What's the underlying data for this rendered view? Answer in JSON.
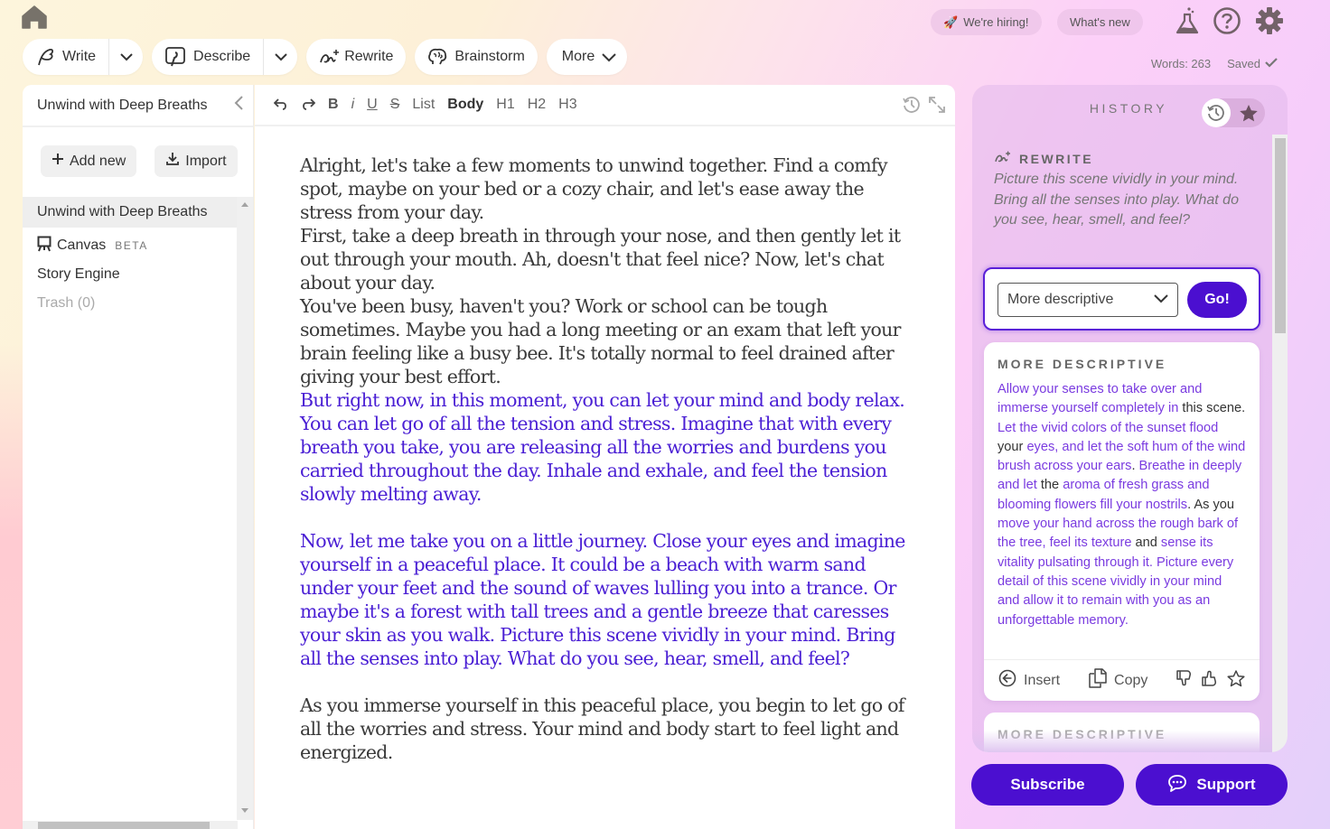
{
  "top": {
    "buttons": [
      {
        "label": "Write",
        "icon": "quill-icon",
        "has_dropdown": true
      },
      {
        "label": "Describe",
        "icon": "describe-icon",
        "has_dropdown": true
      },
      {
        "label": "Rewrite",
        "icon": "rewrite-icon",
        "has_dropdown": false
      },
      {
        "label": "Brainstorm",
        "icon": "brain-icon",
        "has_dropdown": false
      },
      {
        "label": "More",
        "icon": "chevron-down-icon",
        "has_dropdown": true
      }
    ],
    "hiring_label": "We're hiring!",
    "whats_new_label": "What's new",
    "words": "Words: 263",
    "saved": "Saved"
  },
  "sidebar": {
    "doc_title": "Unwind with Deep Breaths",
    "add_new": "Add new",
    "import": "Import",
    "items": [
      {
        "label": "Unwind with Deep Breaths",
        "active": true
      },
      {
        "label": "Canvas",
        "badge": "BETA"
      },
      {
        "label": "Story Engine"
      },
      {
        "label": "Trash (0)"
      }
    ]
  },
  "editor": {
    "toolbar": [
      "List",
      "Body",
      "H1",
      "H2",
      "H3"
    ],
    "format_buttons": {
      "bold": "B",
      "italic": "i",
      "underline": "U",
      "strike": "S"
    },
    "paragraphs": [
      {
        "text": "Alright, let's take a few moments to unwind together. Find a comfy spot, maybe on your bed or a cozy chair, and let's ease away the stress from your day.",
        "generated": false
      },
      {
        "text": "First, take a deep breath in through your nose, and then gently let it out through your mouth. Ah, doesn't that feel nice? Now, let's chat about your day.",
        "generated": false
      },
      {
        "text": "You've been busy, haven't you? Work or school can be tough sometimes. Maybe you had a long meeting or an exam that left your brain feeling like a busy bee. It's totally normal to feel drained after giving your best effort.",
        "generated": false
      },
      {
        "text": "But right now, in this moment, you can let your mind and body relax. You can let go of all the tension and stress. Imagine that with every breath you take, you are releasing all the worries and burdens you carried throughout the day. Inhale and exhale, and feel the tension slowly melting away.",
        "generated": true
      },
      {
        "text": "Now, let me take you on a little journey. Close your eyes and imagine yourself in a peaceful place. It could be a beach with warm sand under your feet and the sound of waves lulling you into a trance. Or maybe it's a forest with tall trees and a gentle breeze that caresses your skin as you walk. Picture this scene vividly in your mind. Bring all the senses into play. What do you see, hear, smell, and feel?",
        "generated": true
      },
      {
        "text": "As you immerse yourself in this peaceful place, you begin to let go of all the worries and stress. Your mind and body start to feel light and energized.",
        "generated": false
      }
    ]
  },
  "history": {
    "title": "HISTORY",
    "rewrite_label": "REWRITE",
    "rewrite_source": "Picture this scene vividly in your mind. Bring all the senses into play. What do you see, hear, smell, and feel?",
    "select_value": "More descriptive",
    "go_label": "Go!",
    "card_title": "MORE DESCRIPTIVE",
    "card_segments": [
      {
        "t": "Allow your senses to take over and immerse yourself completely in ",
        "k": false
      },
      {
        "t": "this scene.",
        "k": true
      },
      {
        "t": " Let the vivid colors of the sunset flood ",
        "k": false
      },
      {
        "t": "your",
        "k": true
      },
      {
        "t": " eyes, and let the soft hum of the wind brush across your ears",
        "k": false
      },
      {
        "t": ". ",
        "k": true
      },
      {
        "t": "Breathe in deeply and let ",
        "k": false
      },
      {
        "t": "the",
        "k": true
      },
      {
        "t": " aroma of fresh grass and blooming flowers fill your nostrils",
        "k": false
      },
      {
        "t": ". As you",
        "k": true
      },
      {
        "t": " move your hand across the rough bark of the tree, feel its texture ",
        "k": false
      },
      {
        "t": "and",
        "k": true
      },
      {
        "t": " sense its vitality pulsating through it. Picture every detail of this scene vividly in your mind and allow it to remain with you as an unforgettable memory.",
        "k": false
      }
    ],
    "insert_label": "Insert",
    "copy_label": "Copy",
    "card2_title": "MORE DESCRIPTIVE"
  },
  "footer": {
    "subscribe": "Subscribe",
    "support": "Support"
  },
  "colors": {
    "accent": "#4b0fd0",
    "generated_text": "#4a1fd4"
  }
}
